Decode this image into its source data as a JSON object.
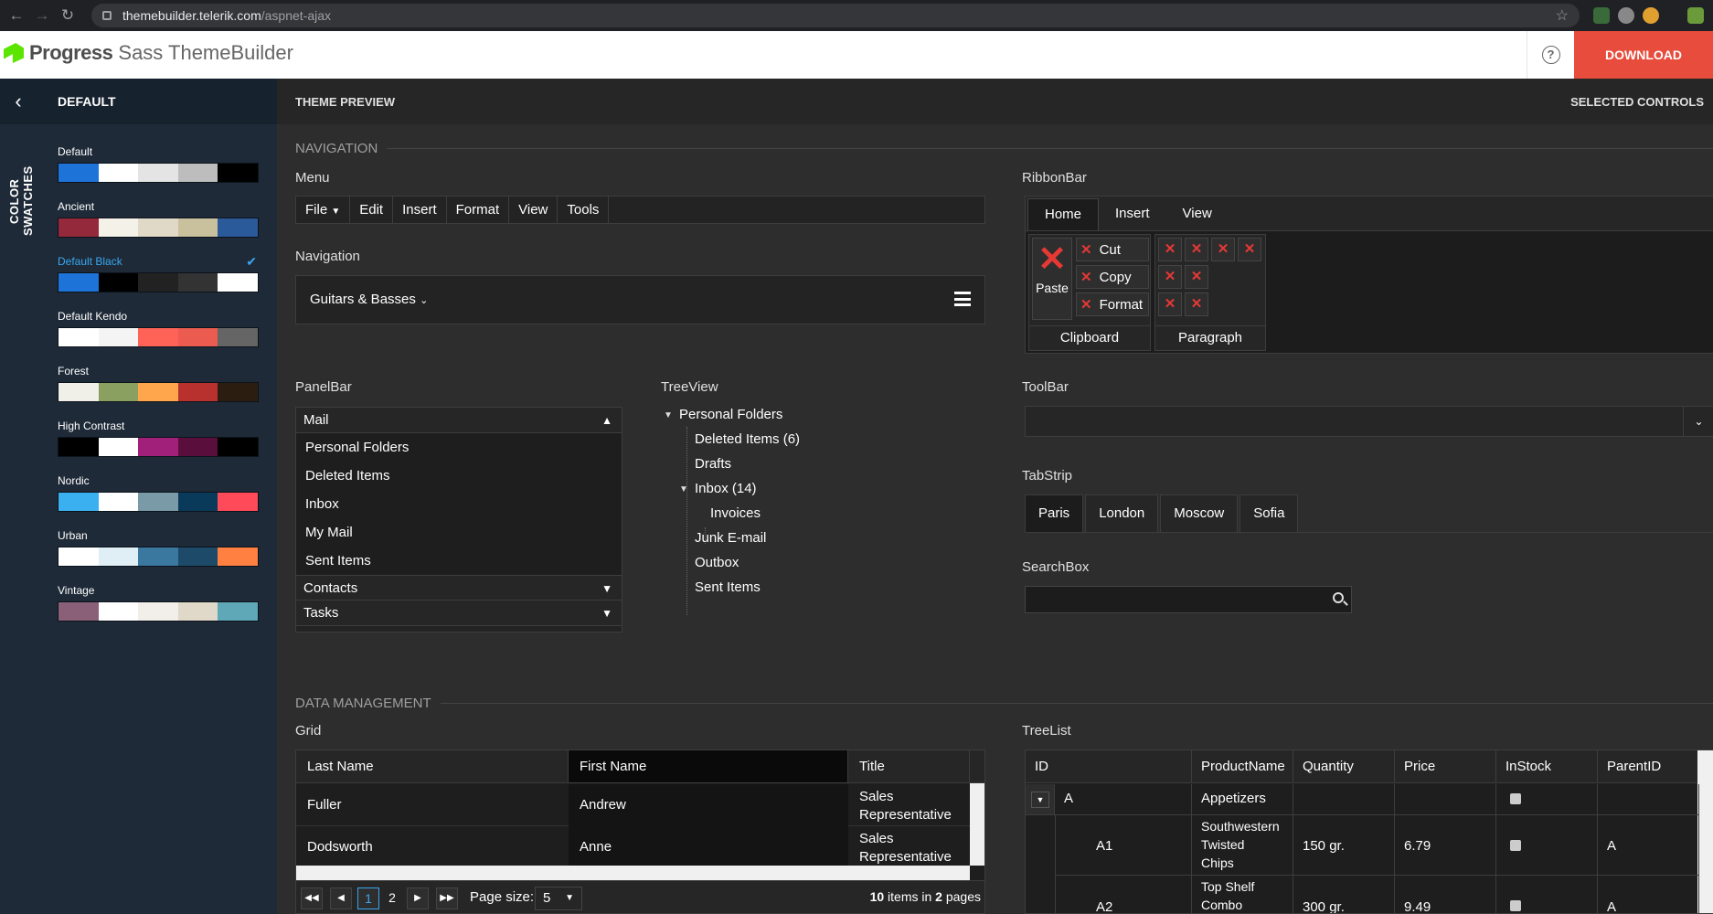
{
  "browser": {
    "host": "themebuilder.telerik.com",
    "path": "/aspnet-ajax"
  },
  "app": {
    "brand": "Progress",
    "product": "Sass ThemeBuilder",
    "help": "?",
    "download": "DOWNLOAD"
  },
  "sidebar": {
    "title": "DEFAULT",
    "vertical_label": "COLOR SWATCHES",
    "swatches": [
      {
        "name": "Default",
        "colors": [
          "#1e73d8",
          "#ffffff",
          "#e4e4e4",
          "#bdbdbd",
          "#000000"
        ]
      },
      {
        "name": "Ancient",
        "colors": [
          "#93293a",
          "#f4f1e8",
          "#e0d9c8",
          "#c9c09e",
          "#2b5a9b"
        ]
      },
      {
        "name": "Default Black",
        "selected": true,
        "colors": [
          "#1e73d8",
          "#000000",
          "#222222",
          "#333333",
          "#ffffff"
        ]
      },
      {
        "name": "Default Kendo",
        "colors": [
          "#ffffff",
          "#f4f4f4",
          "#ff6358",
          "#eb5b4f",
          "#656565"
        ]
      },
      {
        "name": "Forest",
        "colors": [
          "#f0f0e8",
          "#8aa060",
          "#ffa64d",
          "#b8312f",
          "#2b1e10"
        ]
      },
      {
        "name": "High Contrast",
        "colors": [
          "#000000",
          "#ffffff",
          "#a0207a",
          "#5a0e3c",
          "#000000"
        ]
      },
      {
        "name": "Nordic",
        "colors": [
          "#3ab0f0",
          "#ffffff",
          "#7a9aa8",
          "#0a3a5a",
          "#ff4a5a"
        ]
      },
      {
        "name": "Urban",
        "colors": [
          "#ffffff",
          "#e0eef6",
          "#3a78a0",
          "#1e4a6a",
          "#ff8040"
        ]
      },
      {
        "name": "Vintage",
        "colors": [
          "#8a6078",
          "#ffffff",
          "#f2efea",
          "#e0d8c8",
          "#5ea8b8"
        ]
      }
    ]
  },
  "preview": {
    "title": "THEME PREVIEW",
    "selected": "SELECTED CONTROLS"
  },
  "navigation": {
    "section": "NAVIGATION",
    "menu": {
      "label": "Menu",
      "items": [
        "File",
        "Edit",
        "Insert",
        "Format",
        "View",
        "Tools"
      ]
    },
    "nav": {
      "label": "Navigation",
      "item": "Guitars & Basses"
    },
    "ribbon": {
      "label": "RibbonBar",
      "tabs": [
        "Home",
        "Insert",
        "View"
      ],
      "paste": "Paste",
      "cut": "Cut",
      "copy": "Copy",
      "format": "Format",
      "group1": "Clipboard",
      "group2": "Paragraph"
    },
    "panelbar": {
      "label": "PanelBar",
      "mail": "Mail",
      "items": [
        "Personal Folders",
        "Deleted Items",
        "Inbox",
        "My Mail",
        "Sent Items"
      ],
      "contacts": "Contacts",
      "tasks": "Tasks"
    },
    "treeview": {
      "label": "TreeView",
      "root": "Personal Folders",
      "deleted": "Deleted Items (6)",
      "drafts": "Drafts",
      "inbox": "Inbox (14)",
      "invoices": "Invoices",
      "junk": "Junk E-mail",
      "outbox": "Outbox",
      "sent": "Sent Items"
    },
    "toolbar": {
      "label": "ToolBar"
    },
    "tabstrip": {
      "label": "TabStrip",
      "tabs": [
        "Paris",
        "London",
        "Moscow",
        "Sofia"
      ]
    },
    "searchbox": {
      "label": "SearchBox"
    }
  },
  "data": {
    "section": "DATA MANAGEMENT",
    "grid": {
      "label": "Grid",
      "headers": [
        "Last Name",
        "First Name",
        "Title"
      ],
      "rows": [
        {
          "last": "Fuller",
          "first": "Andrew",
          "title1": "Sales",
          "title2": "Representative"
        },
        {
          "last": "Dodsworth",
          "first": "Anne",
          "title1": "Sales",
          "title2": "Representative"
        }
      ],
      "pager": {
        "page1": "1",
        "page2": "2",
        "size_label": "Page size:",
        "size": "5",
        "summary_pre": "10",
        "summary_mid": "items in",
        "summary_pages": "2",
        "summary_post": "pages"
      }
    },
    "treelist": {
      "label": "TreeList",
      "headers": [
        "ID",
        "ProductName",
        "Quantity",
        "Price",
        "InStock",
        "ParentID"
      ],
      "rows": [
        {
          "id": "A",
          "name": "Appetizers"
        },
        {
          "id": "A1",
          "name1": "Southwestern",
          "name2": "Twisted",
          "name3": "Chips",
          "qty": "150 gr.",
          "price": "6.79",
          "parent": "A"
        },
        {
          "id": "A2",
          "name1": "Top Shelf",
          "name2": "Combo",
          "qty": "300 gr.",
          "price": "9.49",
          "parent": "A"
        }
      ]
    }
  }
}
